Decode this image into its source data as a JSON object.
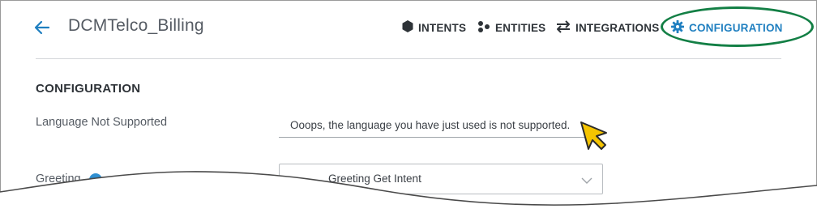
{
  "header": {
    "back_icon": "arrow-left-icon",
    "title": "DCMTelco_Billing"
  },
  "nav": {
    "intents": {
      "label": "INTENTS",
      "icon": "hexagon-icon"
    },
    "entities": {
      "label": "ENTITIES",
      "icon": "entities-dots-icon"
    },
    "integrations": {
      "label": "INTEGRATIONS",
      "icon": "swap-arrows-icon"
    },
    "configuration": {
      "label": "CONFIGURATION",
      "icon": "gear-icon",
      "active": true
    }
  },
  "section": {
    "title": "CONFIGURATION"
  },
  "fields": {
    "language_not_supported": {
      "label": "Language Not Supported",
      "value": "Ooops, the language you have just used is not supported."
    },
    "greeting": {
      "label": "Greeting",
      "value": "Greeting Get Intent"
    }
  },
  "colors": {
    "accent": "#1f7fc0",
    "highlight_ring": "#137f45",
    "cursor": "#f5c400"
  }
}
